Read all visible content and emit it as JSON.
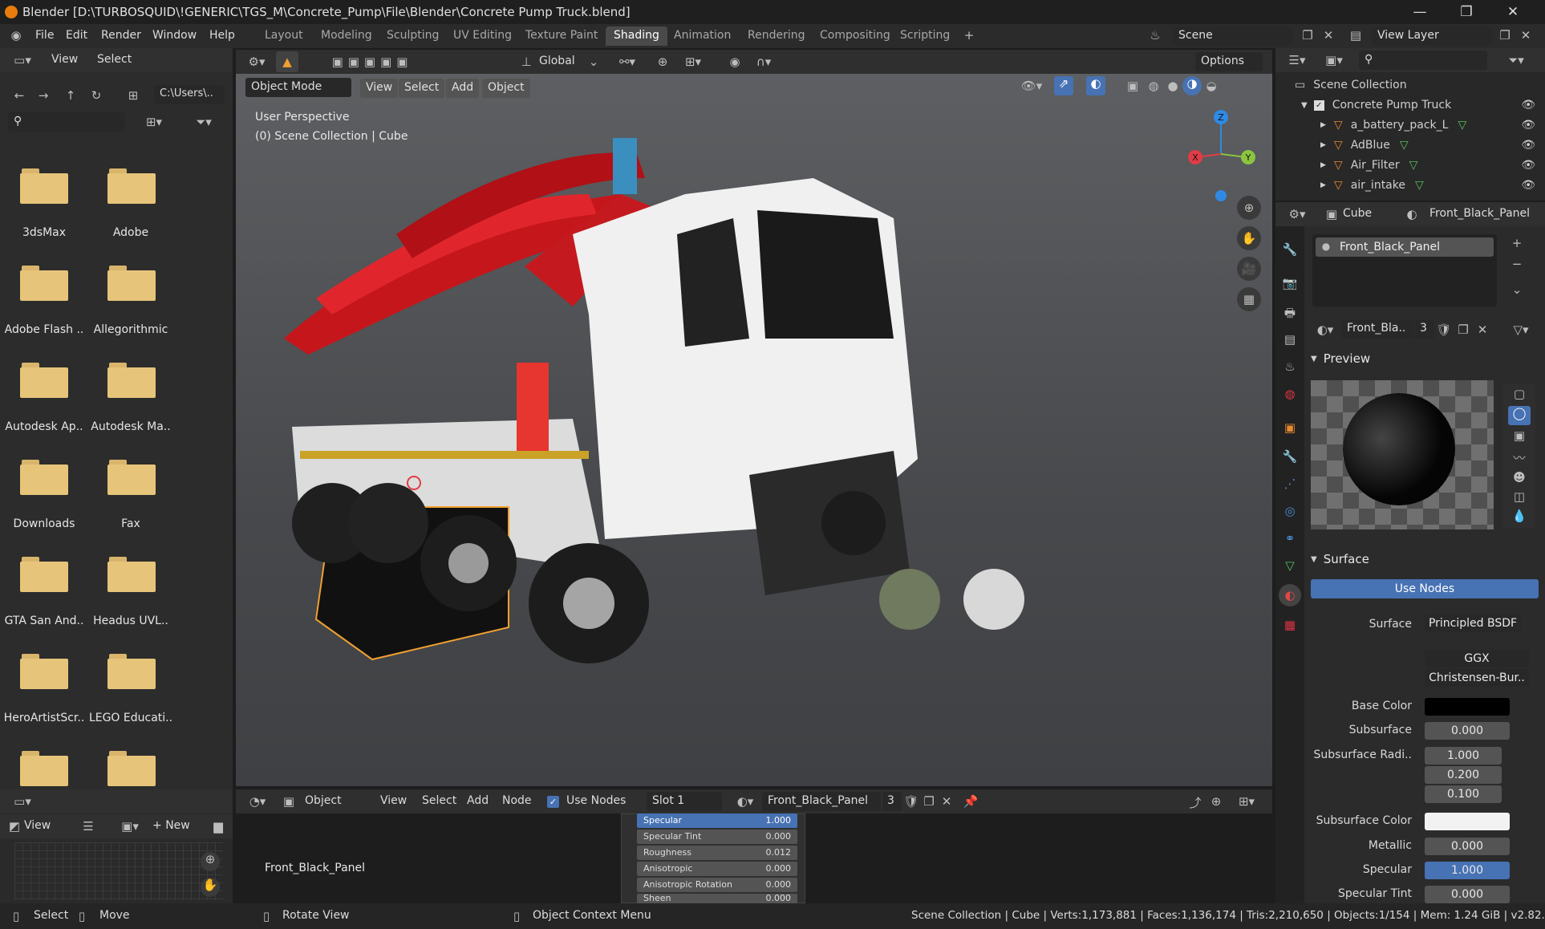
{
  "title": "Blender [D:\\TURBOSQUID\\!GENERIC\\TGS_M\\Concrete_Pump\\File\\Blender\\Concrete Pump Truck.blend]",
  "menu": [
    "File",
    "Edit",
    "Render",
    "Window",
    "Help"
  ],
  "workspaces": [
    "Layout",
    "Modeling",
    "Sculpting",
    "UV Editing",
    "Texture Paint",
    "Shading",
    "Animation",
    "Rendering",
    "Compositing",
    "Scripting"
  ],
  "active_workspace": "Shading",
  "scene": "Scene",
  "view_layer": "View Layer",
  "filebrowser": {
    "menu": [
      "View",
      "Select"
    ],
    "path": "C:\\Users\\..",
    "folders": [
      "3dsMax",
      "Adobe",
      "Adobe Flash ..",
      "Allegorithmic",
      "Autodesk Ap..",
      "Autodesk Ma..",
      "Downloads",
      "Fax",
      "GTA San And..",
      "Headus UVL..",
      "HeroArtistScr..",
      "LEGO Educati.."
    ]
  },
  "viewport": {
    "mode": "Object Mode",
    "menu": [
      "View",
      "Select",
      "Add",
      "Object"
    ],
    "transform": "Global",
    "options": "Options",
    "overlay_line1": "User Perspective",
    "overlay_line2": "(0) Scene Collection | Cube",
    "gizmo": {
      "x": "X",
      "y": "Y",
      "z": "Z"
    },
    "colors": {
      "x": "#e13c46",
      "y": "#8bc53f",
      "z": "#2f8ae5",
      "selection": "#f0a030"
    }
  },
  "outliner": {
    "root": "Scene Collection",
    "collection": "Concrete Pump Truck",
    "items": [
      "a_battery_pack_L",
      "AdBlue",
      "Air_Filter",
      "air_intake"
    ]
  },
  "properties": {
    "object": "Cube",
    "material": "Front_Black_Panel",
    "slot_name": "Front_Black_Panel",
    "mat_short": "Front_Bla..",
    "users": "3",
    "preview_label": "Preview",
    "surface_label": "Surface",
    "use_nodes": "Use Nodes",
    "rows": [
      {
        "label": "Surface",
        "value": "Principled BSDF"
      },
      {
        "label": "",
        "value": "GGX"
      },
      {
        "label": "",
        "value": "Christensen-Bur.."
      },
      {
        "label": "Base Color",
        "value": ""
      },
      {
        "label": "Subsurface",
        "value": "0.000"
      },
      {
        "label": "Subsurface Radi..",
        "value": "1.000"
      },
      {
        "label": "",
        "value": "0.200"
      },
      {
        "label": "",
        "value": "0.100"
      },
      {
        "label": "Subsurface Color",
        "value": ""
      },
      {
        "label": "Metallic",
        "value": "0.000"
      },
      {
        "label": "Specular",
        "value": "1.000"
      },
      {
        "label": "Specular Tint",
        "value": "0.000"
      }
    ]
  },
  "nodeeditor": {
    "object": "Object",
    "menu": [
      "View",
      "Select",
      "Add",
      "Node"
    ],
    "use_nodes": "Use Nodes",
    "slot": "Slot 1",
    "material": "Front_Black_Panel",
    "users": "3",
    "node_label": "Front_Black_Panel",
    "rows": [
      {
        "label": "Specular",
        "value": "1.000"
      },
      {
        "label": "Specular Tint",
        "value": "0.000"
      },
      {
        "label": "Roughness",
        "value": "0.012"
      },
      {
        "label": "Anisotropic",
        "value": "0.000"
      },
      {
        "label": "Anisotropic Rotation",
        "value": "0.000"
      },
      {
        "label": "Sheen",
        "value": "0.000"
      }
    ]
  },
  "image_editor": {
    "view": "View",
    "new": "New"
  },
  "status": {
    "select": "Select",
    "move": "Move",
    "rotate": "Rotate View",
    "context": "Object Context Menu",
    "stats": "Scene Collection | Cube | Verts:1,173,881 | Faces:1,136,174 | Tris:2,210,650 | Objects:1/154 | Mem: 1.24 GiB | v2.82.7"
  }
}
